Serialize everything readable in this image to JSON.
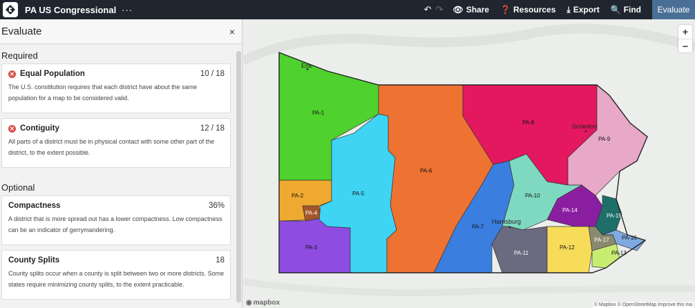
{
  "app": {
    "title": "PA US Congressional",
    "more": "···"
  },
  "toolbar": {
    "share": "Share",
    "resources": "Resources",
    "export": "Export",
    "find": "Find",
    "evaluate": "Evaluate"
  },
  "panel": {
    "title": "Evaluate",
    "close": "×",
    "required_label": "Required",
    "optional_label": "Optional",
    "required": [
      {
        "name": "Equal Population",
        "score": "10 / 18",
        "desc": "The U.S. constitution requires that each district have about the same population for a map to be considered valid."
      },
      {
        "name": "Contiguity",
        "score": "12 / 18",
        "desc": "All parts of a district must be in physical contact with some other part of the district, to the extent possible."
      }
    ],
    "optional": [
      {
        "name": "Compactness",
        "score": "36%",
        "desc": "A district that is more spread out has a lower compactness. Low compactness can be an indicator of gerrymandering."
      },
      {
        "name": "County Splits",
        "score": "18",
        "desc": "County splits occur when a county is split between two or more districts. Some states require minimizing county splits, to the extent practicable."
      }
    ]
  },
  "map": {
    "cities": {
      "erie": "Erie",
      "scranton": "Scranton",
      "harrisburg": "Harrisburg"
    },
    "districts": {
      "pa1": "PA-1",
      "pa2": "PA-2",
      "pa3": "PA-3",
      "pa4": "PA-4",
      "pa5": "PA-5",
      "pa6": "PA-6",
      "pa7": "PA-7",
      "pa8": "PA-8",
      "pa9": "PA-9",
      "pa10": "PA-10",
      "pa11": "PA-11",
      "pa12": "PA-12",
      "pa13": "PA-13",
      "pa14": "PA-14",
      "pa15": "PA-15",
      "pa16": "PA-16",
      "pa17": "PA-17"
    },
    "colors": {
      "pa1": "#4fd12e",
      "pa2": "#f0a930",
      "pa3": "#8e4de0",
      "pa4": "#a3562a",
      "pa5": "#3fd4f4",
      "pa6": "#ee7232",
      "pa7": "#3a7ee0",
      "pa8": "#e3185e",
      "pa9": "#e8a8c8",
      "pa10": "#7fd9c0",
      "pa11": "#6a6a80",
      "pa12": "#f7dc5a",
      "pa13": "#c8ec70",
      "pa14": "#8a1ea0",
      "pa15": "#1e6f6a",
      "pa16": "#7fa9e0",
      "pa17": "#8a8a70"
    },
    "zoom_in": "+",
    "zoom_out": "−",
    "mapbox": "mapbox",
    "attribution": "© Mapbox © OpenStreetMap Improve this ma"
  }
}
